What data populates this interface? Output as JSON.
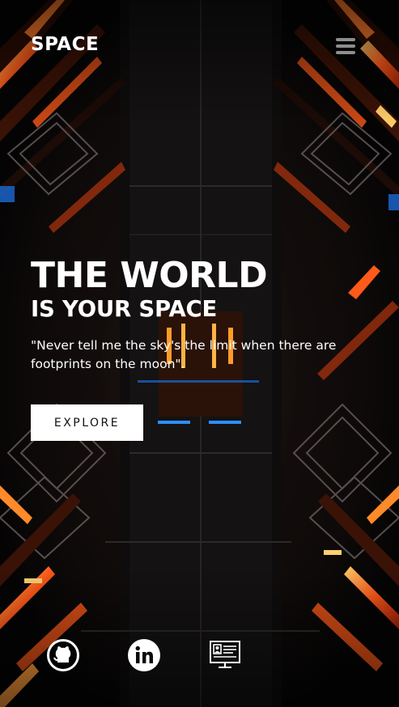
{
  "header": {
    "logo_text": "SPACE",
    "menu_icon": "hamburger-menu-icon"
  },
  "hero": {
    "title": "THE WORLD",
    "subtitle": "IS YOUR SPACE",
    "quote": "\"Never tell me the sky's the limit when there are footprints on the moon\".",
    "cta_label": "EXPLORE"
  },
  "social_links": [
    {
      "icon": "github-icon"
    },
    {
      "icon": "linkedin-icon"
    },
    {
      "icon": "resume-icon"
    }
  ],
  "colors": {
    "background": "#070606",
    "accent_glow": "#ff5a1a",
    "accent_blue": "#1a8cff",
    "text": "#ffffff",
    "button_bg": "#ffffff",
    "button_text": "#111111"
  }
}
